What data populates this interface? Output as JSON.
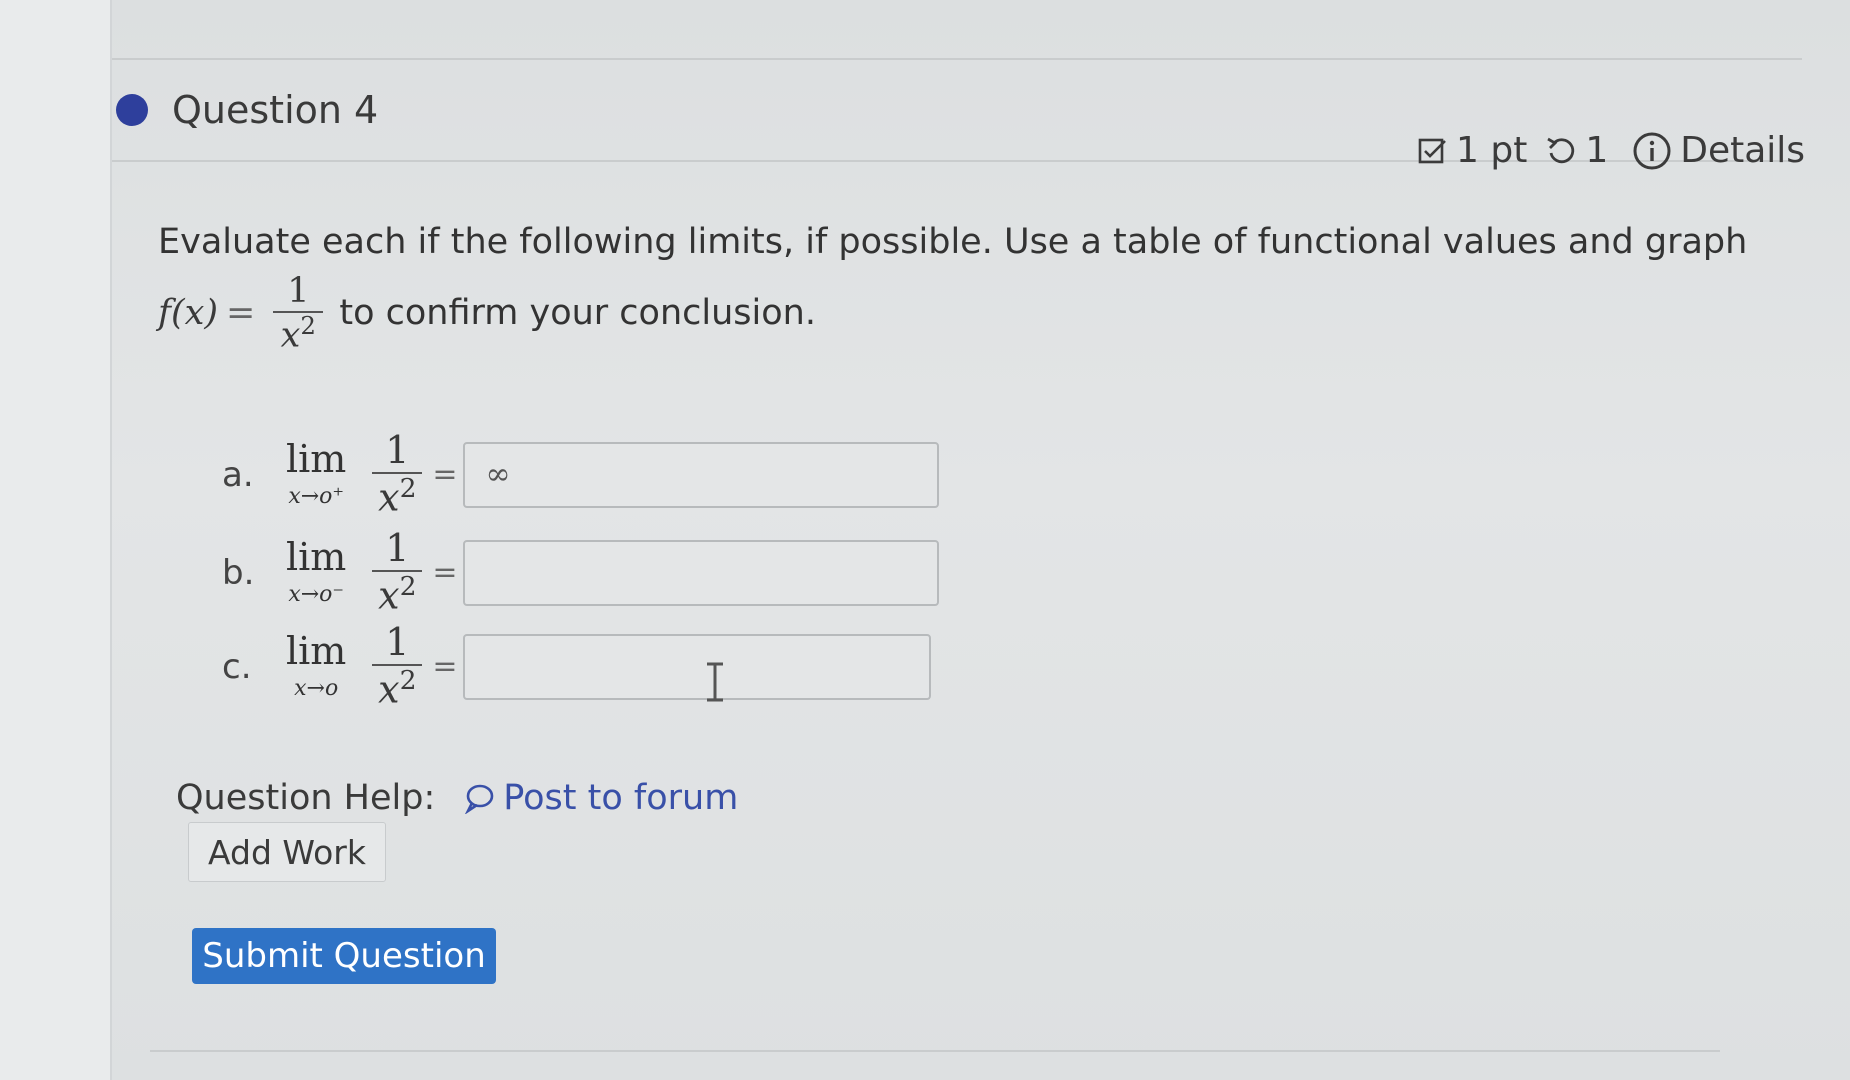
{
  "question": {
    "title": "Question 4",
    "points": "1 pt",
    "attempts": "1",
    "details_label": "Details"
  },
  "prompt": {
    "line1": "Evaluate each if the following limits, if possible.  Use a table of functional values and graph",
    "fx_label": "f(x)",
    "equals": "=",
    "fraction_numerator": "1",
    "fraction_denominator": "x",
    "fraction_exponent": "2",
    "line2": "to confirm your conclusion."
  },
  "parts": [
    {
      "letter": "a.",
      "lim": "lim",
      "subscript": "x→o⁺",
      "numerator": "1",
      "denominator": "x",
      "exponent": "2",
      "equals": "=",
      "answer": "∞"
    },
    {
      "letter": "b.",
      "lim": "lim",
      "subscript": "x→o⁻",
      "numerator": "1",
      "denominator": "x",
      "exponent": "2",
      "equals": "=",
      "answer": ""
    },
    {
      "letter": "c.",
      "lim": "lim",
      "subscript": "x→o",
      "numerator": "1",
      "denominator": "x",
      "exponent": "2",
      "equals": "=",
      "answer": ""
    }
  ],
  "help": {
    "label": "Question Help:",
    "forum_link": "Post to forum"
  },
  "buttons": {
    "add_work": "Add Work",
    "submit": "Submit Question"
  },
  "colors": {
    "accent_dot": "#2e3f9c",
    "link": "#3950a8",
    "submit_bg": "#2f73c6"
  }
}
